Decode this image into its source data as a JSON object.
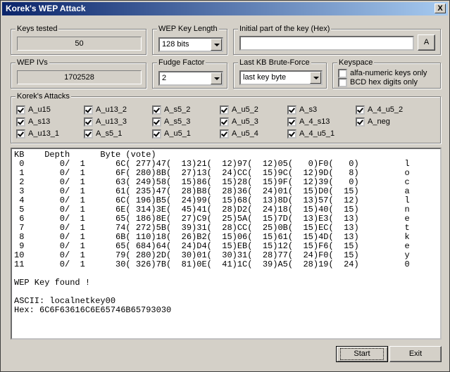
{
  "window": {
    "title": "Korek's WEP Attack",
    "close_glyph": "X"
  },
  "keys_tested": {
    "label": "Keys tested",
    "value": "50"
  },
  "wep_key_length": {
    "label": "WEP Key Length",
    "value": "128 bits"
  },
  "initial_key": {
    "label": "Initial part of the key (Hex)",
    "value": "",
    "button": "A"
  },
  "wep_ivs": {
    "label": "WEP IVs",
    "value": "1702528"
  },
  "fudge_factor": {
    "label": "Fudge Factor",
    "value": "2"
  },
  "last_kb": {
    "label": "Last KB Brute-Force",
    "value": "last key byte"
  },
  "keyspace": {
    "label": "Keyspace",
    "options": [
      {
        "label": "alfa-numeric keys only",
        "checked": false
      },
      {
        "label": "BCD hex digits only",
        "checked": false
      }
    ]
  },
  "attacks": {
    "label": "Korek's Attacks",
    "items": [
      {
        "label": "A_u15",
        "checked": true
      },
      {
        "label": "A_u13_2",
        "checked": true
      },
      {
        "label": "A_s5_2",
        "checked": true
      },
      {
        "label": "A_u5_2",
        "checked": true
      },
      {
        "label": "A_s3",
        "checked": true
      },
      {
        "label": "A_4_u5_2",
        "checked": true
      },
      {
        "label": "A_s13",
        "checked": true
      },
      {
        "label": "A_u13_3",
        "checked": true
      },
      {
        "label": "A_s5_3",
        "checked": true
      },
      {
        "label": "A_u5_3",
        "checked": true
      },
      {
        "label": "A_4_s13",
        "checked": true
      },
      {
        "label": "A_neg",
        "checked": true
      },
      {
        "label": "A_u13_1",
        "checked": true
      },
      {
        "label": "A_s5_1",
        "checked": true
      },
      {
        "label": "A_u5_1",
        "checked": true
      },
      {
        "label": "A_u5_4",
        "checked": true
      },
      {
        "label": "A_4_u5_1",
        "checked": true
      }
    ]
  },
  "output": {
    "header": "KB    Depth      Byte (vote)",
    "rows": [
      " 0       0/  1      6C( 277)47(  13)21(  12)97(  12)05(   0)F0(   0)         l",
      " 1       0/  1      6F( 280)8B(  27)13(  24)CC(  15)9C(  12)9D(   8)         o",
      " 2       0/  1      63( 249)58(  15)86(  15)28(  15)9F(  12)39(   0)         c",
      " 3       0/  1      61( 235)47(  28)B8(  28)36(  24)01(  15)D0(  15)         a",
      " 4       0/  1      6C( 196)B5(  24)99(  15)68(  13)8D(  13)57(  12)         l",
      " 5       0/  1      6E( 314)3E(  45)41(  28)D2(  24)18(  15)40(  15)         n",
      " 6       0/  1      65( 186)8E(  27)C9(  25)5A(  15)7D(  13)E3(  13)         e",
      " 7       0/  1      74( 272)5B(  39)31(  28)CC(  25)0B(  15)EC(  13)         t",
      " 8       0/  1      6B( 110)18(  26)B2(  15)06(  15)61(  15)4D(  13)         k",
      " 9       0/  1      65( 684)64(  24)D4(  15)EB(  15)12(  15)F6(  15)         e",
      "10       0/  1      79( 280)2D(  30)01(  30)31(  28)77(  24)F0(  15)         y",
      "11       0/  1      30( 326)7B(  81)0E(  41)1C(  39)A5(  28)19(  24)         0"
    ],
    "found": "WEP Key found !",
    "ascii": "ASCII: localnetkey00",
    "hex": "Hex: 6C6F63616C6E65746B65793030"
  },
  "buttons": {
    "start": "Start",
    "exit": "Exit"
  }
}
